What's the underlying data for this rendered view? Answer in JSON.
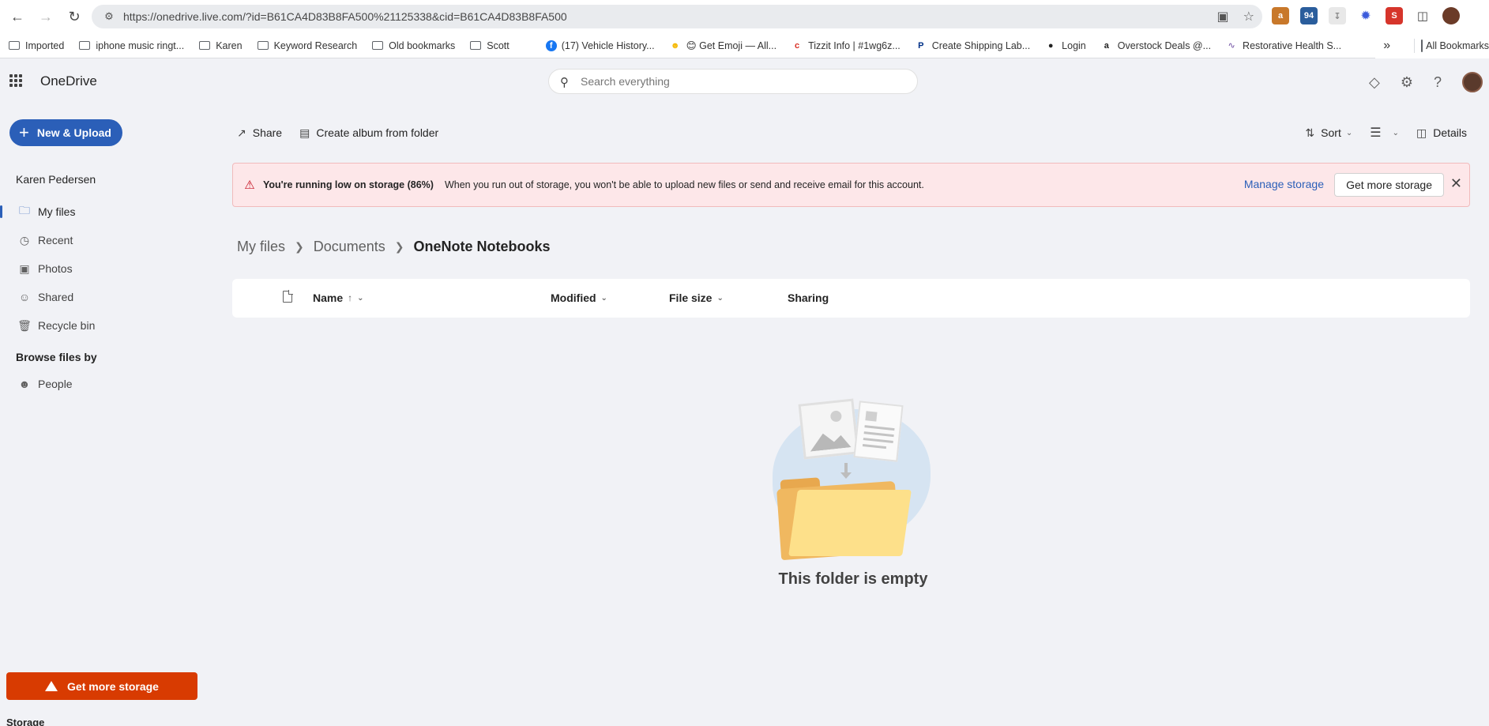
{
  "browser": {
    "url": "https://onedrive.live.com/?id=B61CA4D83B8FA500%21125338&cid=B61CA4D83B8FA500",
    "bookmarks": [
      {
        "label": "Imported",
        "icon": "folder-icon"
      },
      {
        "label": "iphone music ringt...",
        "icon": "folder-icon"
      },
      {
        "label": "Karen",
        "icon": "folder-icon"
      },
      {
        "label": "Keyword Research",
        "icon": "folder-icon"
      },
      {
        "label": "Old bookmarks",
        "icon": "folder-icon"
      },
      {
        "label": "Scott",
        "icon": "folder-icon"
      },
      {
        "label": "(17) Vehicle History...",
        "icon": "facebook-icon"
      },
      {
        "label": "😊 Get Emoji — All...",
        "icon": "emoji-icon"
      },
      {
        "label": "Tizzit Info | #1wg6z...",
        "icon": "tizzit-icon"
      },
      {
        "label": "Create Shipping Lab...",
        "icon": "paypal-icon"
      },
      {
        "label": "Login",
        "icon": "globe-icon"
      },
      {
        "label": "Overstock Deals @...",
        "icon": "amazon-icon"
      },
      {
        "label": "Restorative Health S...",
        "icon": "health-icon"
      }
    ],
    "all_bookmarks": "All Bookmarks"
  },
  "header": {
    "app_name": "OneDrive",
    "search_placeholder": "Search everything"
  },
  "sidebar": {
    "new_button": "New & Upload",
    "user_name": "Karen Pedersen",
    "items": [
      {
        "label": "My files",
        "icon": "folder-icon",
        "active": true
      },
      {
        "label": "Recent",
        "icon": "clock-icon"
      },
      {
        "label": "Photos",
        "icon": "photo-icon"
      },
      {
        "label": "Shared",
        "icon": "people-icon"
      },
      {
        "label": "Recycle bin",
        "icon": "trash-icon"
      }
    ],
    "browse_title": "Browse files by",
    "people": "People",
    "get_more_storage": "Get more storage",
    "storage_label": "Storage"
  },
  "commands": {
    "share": "Share",
    "create_album": "Create album from folder",
    "sort": "Sort",
    "details": "Details"
  },
  "banner": {
    "title": "You're running low on storage (86%)",
    "message": "When you run out of storage, you won't be able to upload new files or send and receive email for this account.",
    "manage": "Manage storage",
    "get_more": "Get more storage",
    "accent_color": "#c50f1f"
  },
  "breadcrumb": {
    "items": [
      "My files",
      "Documents"
    ],
    "current": "OneNote Notebooks"
  },
  "table": {
    "columns": [
      "Name",
      "Modified",
      "File size",
      "Sharing"
    ],
    "sort_indicator": "↑"
  },
  "empty_state": {
    "message": "This folder is empty"
  },
  "colors": {
    "brand": "#2b5fb8",
    "warning_button": "#d83b01"
  }
}
